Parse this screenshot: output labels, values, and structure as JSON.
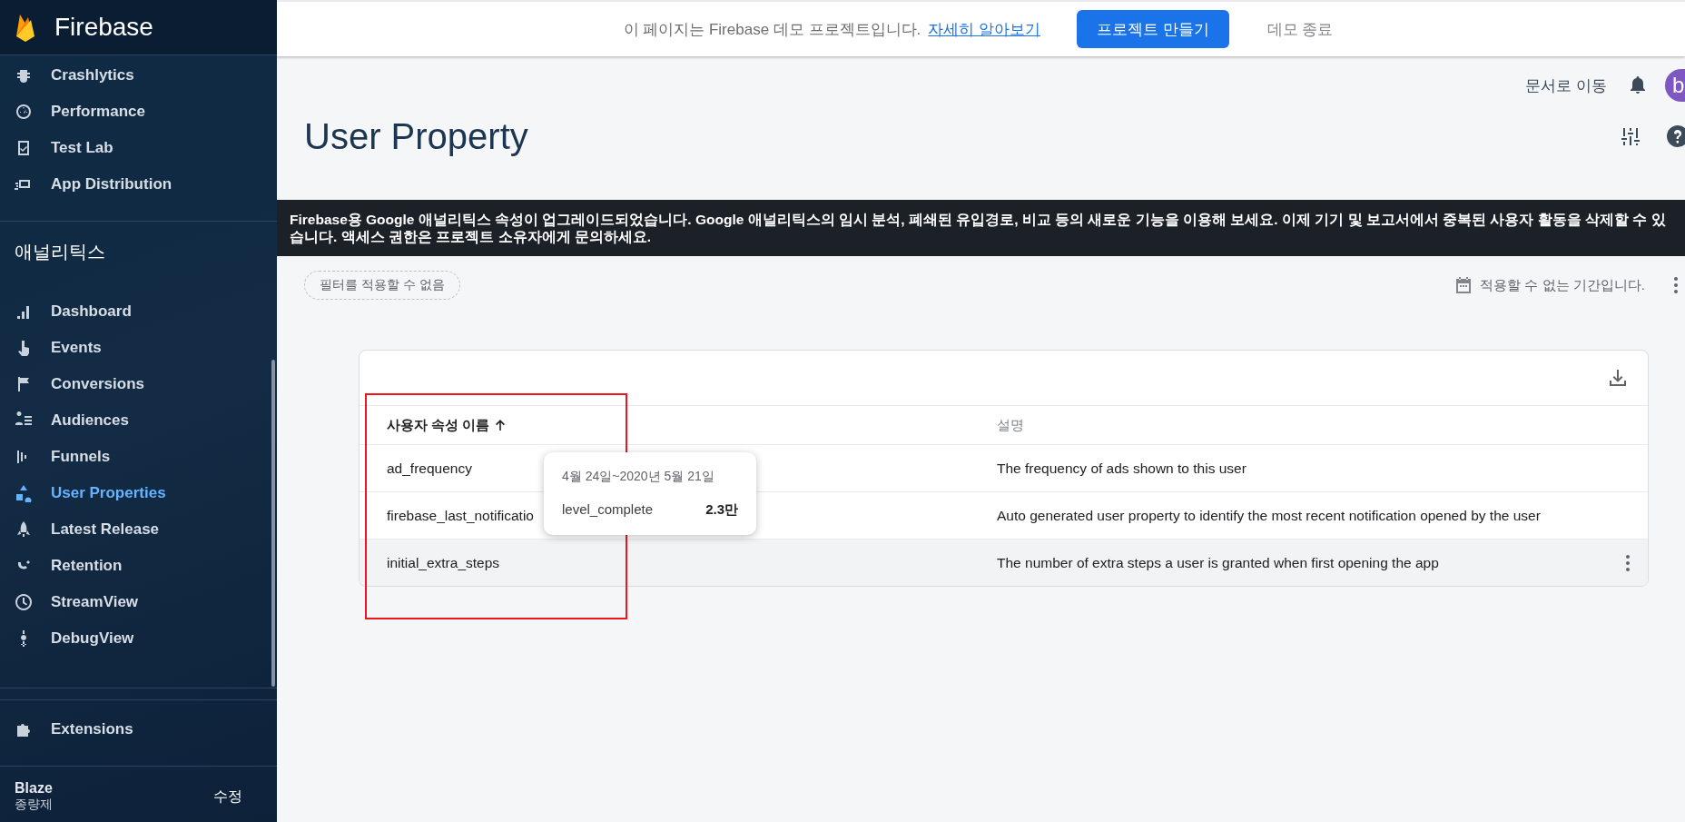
{
  "sidebar": {
    "brand": "Firebase",
    "top_items": [
      {
        "label": "Crashlytics",
        "selected": false
      },
      {
        "label": "Performance",
        "selected": false
      },
      {
        "label": "Test Lab",
        "selected": false
      },
      {
        "label": "App Distribution",
        "selected": false
      }
    ],
    "section_title": "애널리틱스",
    "analytics_items": [
      {
        "label": "Dashboard",
        "selected": false
      },
      {
        "label": "Events",
        "selected": false
      },
      {
        "label": "Conversions",
        "selected": false
      },
      {
        "label": "Audiences",
        "selected": false
      },
      {
        "label": "Funnels",
        "selected": false
      },
      {
        "label": "User Properties",
        "selected": true
      },
      {
        "label": "Latest Release",
        "selected": false
      },
      {
        "label": "Retention",
        "selected": false
      },
      {
        "label": "StreamView",
        "selected": false
      },
      {
        "label": "DebugView",
        "selected": false
      }
    ],
    "extensions": {
      "label": "Extensions",
      "selected": false
    },
    "plan": {
      "name": "Blaze",
      "type": "종량제",
      "action": "수정"
    }
  },
  "demo_bar": {
    "message": "이 페이지는 Firebase 데모 프로젝트입니다.",
    "link": "자세히 알아보기",
    "button": "프로젝트 만들기",
    "exit": "데모 종료"
  },
  "header": {
    "docs_link": "문서로 이동",
    "avatar": "b",
    "title": "User Property"
  },
  "notice": "Firebase용 Google 애널리틱스 속성이 업그레이드되었습니다. Google 애널리틱스의 임시 분석, 폐쇄된 유입경로, 비교 등의 새로운 기능을 이용해 보세요. 이제 기기 및 보고서에서 중복된 사용자 활동을 삭제할 수 있습니다. 액세스 권한은 프로젝트 소유자에게 문의하세요.",
  "filter": {
    "chip": "필터를 적용할 수 없음",
    "date": "적용할 수 없는 기간입니다."
  },
  "table": {
    "columns": [
      {
        "label": "사용자 속성 이름",
        "sorted": true
      },
      {
        "label": "설명",
        "sorted": false
      }
    ],
    "rows": [
      {
        "name": "ad_frequency",
        "description": "The frequency of ads shown to this user",
        "highlighted": false
      },
      {
        "name": "firebase_last_notificatio",
        "description": "Auto generated user property to identify the most recent notification opened by the user",
        "highlighted": false
      },
      {
        "name": "initial_extra_steps",
        "description": "The number of extra steps a user is granted when first opening the app",
        "highlighted": true
      }
    ]
  },
  "tooltip": {
    "date_range": "4월 24일~2020년 5월 21일",
    "label": "level_complete",
    "value": "2.3만"
  }
}
